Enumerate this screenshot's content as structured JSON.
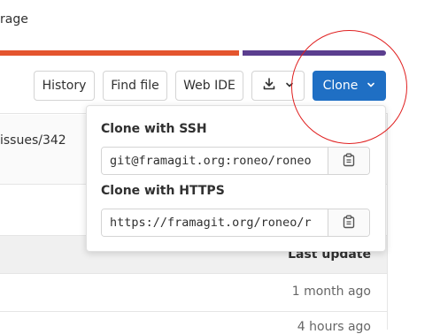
{
  "page": {
    "partial_title": "rage",
    "issue_link": "issues/342"
  },
  "toolbar": {
    "history_label": "History",
    "find_file_label": "Find file",
    "web_ide_label": "Web IDE",
    "clone_label": "Clone"
  },
  "clone_dropdown": {
    "ssh_label": "Clone with SSH",
    "ssh_url": "git@framagit.org:roneo/roneo",
    "https_label": "Clone with HTTPS",
    "https_url": "https://framagit.org/roneo/r"
  },
  "file_table": {
    "header_last_update": "Last update",
    "rows": [
      {
        "last_update": "1 month ago"
      },
      {
        "last_update": "4 hours ago"
      }
    ]
  },
  "colors": {
    "accent_blue": "#1f6fc4",
    "bar_orange": "#e4552e",
    "bar_purple": "#5b3e8f",
    "annotation_red": "#e02020"
  },
  "icons": {
    "download": "download-icon",
    "chevron": "chevron-down-icon",
    "copy": "copy-clipboard-icon"
  }
}
